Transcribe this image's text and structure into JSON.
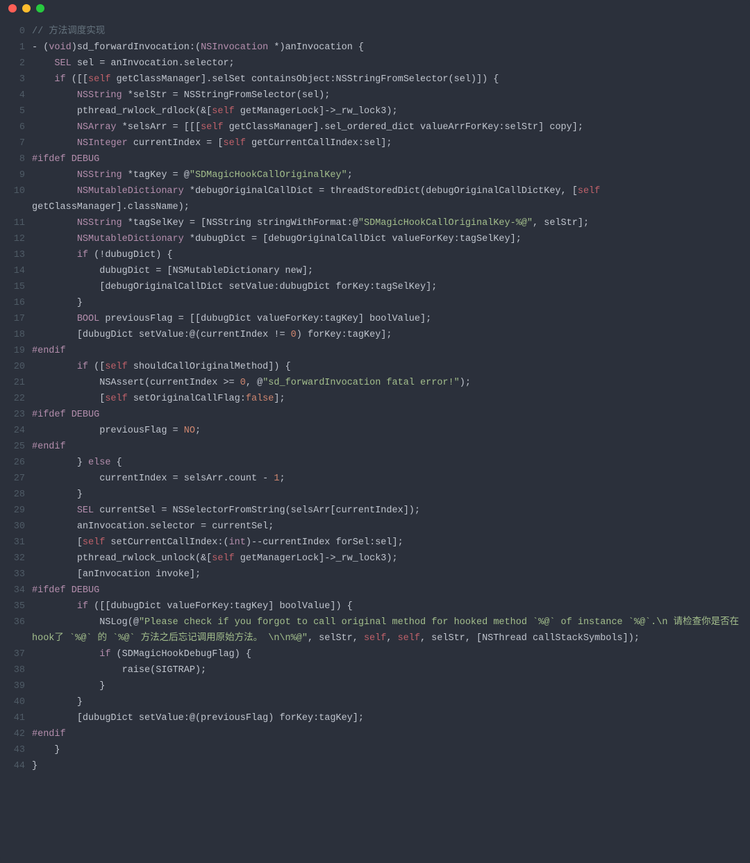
{
  "titlebar": {
    "dots": [
      "close",
      "minimize",
      "zoom"
    ]
  },
  "lines": [
    {
      "n": 0,
      "tokens": [
        {
          "c": "cmt",
          "t": "// 方法调度实现"
        }
      ]
    },
    {
      "n": 1,
      "tokens": [
        {
          "c": "op",
          "t": "- ("
        },
        {
          "c": "typ",
          "t": "void"
        },
        {
          "c": "op",
          "t": ")sd_forwardInvocation:("
        },
        {
          "c": "typ",
          "t": "NSInvocation"
        },
        {
          "c": "op",
          "t": " *)anInvocation {"
        }
      ]
    },
    {
      "n": 2,
      "tokens": [
        {
          "c": "op",
          "t": "    "
        },
        {
          "c": "typ",
          "t": "SEL"
        },
        {
          "c": "op",
          "t": " sel = anInvocation.selector;"
        }
      ]
    },
    {
      "n": 3,
      "tokens": [
        {
          "c": "op",
          "t": "    "
        },
        {
          "c": "kw",
          "t": "if"
        },
        {
          "c": "op",
          "t": " ([["
        },
        {
          "c": "self",
          "t": "self"
        },
        {
          "c": "op",
          "t": " getClassManager].selSet containsObject:NSStringFromSelector(sel)]) {"
        }
      ]
    },
    {
      "n": 4,
      "tokens": [
        {
          "c": "op",
          "t": "        "
        },
        {
          "c": "typ",
          "t": "NSString"
        },
        {
          "c": "op",
          "t": " *selStr = NSStringFromSelector(sel);"
        }
      ]
    },
    {
      "n": 5,
      "tokens": [
        {
          "c": "op",
          "t": "        pthread_rwlock_rdlock(&["
        },
        {
          "c": "self",
          "t": "self"
        },
        {
          "c": "op",
          "t": " getManagerLock]->_rw_lock3);"
        }
      ]
    },
    {
      "n": 6,
      "tokens": [
        {
          "c": "op",
          "t": "        "
        },
        {
          "c": "typ",
          "t": "NSArray"
        },
        {
          "c": "op",
          "t": " *selsArr = [[["
        },
        {
          "c": "self",
          "t": "self"
        },
        {
          "c": "op",
          "t": " getClassManager].sel_ordered_dict valueArrForKey:selStr] "
        },
        {
          "c": "fn",
          "t": "copy"
        },
        {
          "c": "op",
          "t": "];"
        }
      ]
    },
    {
      "n": 7,
      "tokens": [
        {
          "c": "op",
          "t": "        "
        },
        {
          "c": "typ",
          "t": "NSInteger"
        },
        {
          "c": "op",
          "t": " currentIndex = ["
        },
        {
          "c": "self",
          "t": "self"
        },
        {
          "c": "op",
          "t": " getCurrentCallIndex:sel];"
        }
      ]
    },
    {
      "n": 8,
      "tokens": [
        {
          "c": "pre",
          "t": "#ifdef DEBUG"
        }
      ]
    },
    {
      "n": 9,
      "tokens": [
        {
          "c": "op",
          "t": "        "
        },
        {
          "c": "typ",
          "t": "NSString"
        },
        {
          "c": "op",
          "t": " *tagKey = @"
        },
        {
          "c": "str",
          "t": "\"SDMagicHookCallOriginalKey\""
        },
        {
          "c": "op",
          "t": ";"
        }
      ]
    },
    {
      "n": 10,
      "tokens": [
        {
          "c": "op",
          "t": "        "
        },
        {
          "c": "typ",
          "t": "NSMutableDictionary"
        },
        {
          "c": "op",
          "t": " *debugOriginalCallDict = threadStoredDict(debugOriginalCallDictKey, ["
        },
        {
          "c": "self",
          "t": "self"
        },
        {
          "c": "op",
          "t": " getClassManager].className);"
        }
      ]
    },
    {
      "n": 11,
      "tokens": [
        {
          "c": "op",
          "t": "        "
        },
        {
          "c": "typ",
          "t": "NSString"
        },
        {
          "c": "op",
          "t": " *tagSelKey = [NSString stringWithFormat:@"
        },
        {
          "c": "str",
          "t": "\"SDMagicHookCallOriginalKey-%@\""
        },
        {
          "c": "op",
          "t": ", selStr];"
        }
      ]
    },
    {
      "n": 12,
      "tokens": [
        {
          "c": "op",
          "t": "        "
        },
        {
          "c": "typ",
          "t": "NSMutableDictionary"
        },
        {
          "c": "op",
          "t": " *dubugDict = [debugOriginalCallDict valueForKey:tagSelKey];"
        }
      ]
    },
    {
      "n": 13,
      "tokens": [
        {
          "c": "op",
          "t": "        "
        },
        {
          "c": "kw",
          "t": "if"
        },
        {
          "c": "op",
          "t": " (!dubugDict) {"
        }
      ]
    },
    {
      "n": 14,
      "tokens": [
        {
          "c": "op",
          "t": "            dubugDict = [NSMutableDictionary new];"
        }
      ]
    },
    {
      "n": 15,
      "tokens": [
        {
          "c": "op",
          "t": "            [debugOriginalCallDict setValue:dubugDict forKey:tagSelKey];"
        }
      ]
    },
    {
      "n": 16,
      "tokens": [
        {
          "c": "op",
          "t": "        }"
        }
      ]
    },
    {
      "n": 17,
      "tokens": [
        {
          "c": "op",
          "t": "        "
        },
        {
          "c": "typ",
          "t": "BOOL"
        },
        {
          "c": "op",
          "t": " previousFlag = [[dubugDict valueForKey:tagKey] boolValue];"
        }
      ]
    },
    {
      "n": 18,
      "tokens": [
        {
          "c": "op",
          "t": "        [dubugDict setValue:@(currentIndex != "
        },
        {
          "c": "num",
          "t": "0"
        },
        {
          "c": "op",
          "t": ") forKey:tagKey];"
        }
      ]
    },
    {
      "n": 19,
      "tokens": [
        {
          "c": "pre",
          "t": "#endif"
        }
      ]
    },
    {
      "n": 20,
      "tokens": [
        {
          "c": "op",
          "t": "        "
        },
        {
          "c": "kw",
          "t": "if"
        },
        {
          "c": "op",
          "t": " (["
        },
        {
          "c": "self",
          "t": "self"
        },
        {
          "c": "op",
          "t": " shouldCallOriginalMethod]) {"
        }
      ]
    },
    {
      "n": 21,
      "tokens": [
        {
          "c": "op",
          "t": "            NSAssert(currentIndex >= "
        },
        {
          "c": "num",
          "t": "0"
        },
        {
          "c": "op",
          "t": ", @"
        },
        {
          "c": "str",
          "t": "\"sd_forwardInvocation fatal error!\""
        },
        {
          "c": "op",
          "t": ");"
        }
      ]
    },
    {
      "n": 22,
      "tokens": [
        {
          "c": "op",
          "t": "            ["
        },
        {
          "c": "self",
          "t": "self"
        },
        {
          "c": "op",
          "t": " setOriginalCallFlag:"
        },
        {
          "c": "con",
          "t": "false"
        },
        {
          "c": "op",
          "t": "];"
        }
      ]
    },
    {
      "n": 23,
      "tokens": [
        {
          "c": "pre",
          "t": "#ifdef DEBUG"
        }
      ]
    },
    {
      "n": 24,
      "tokens": [
        {
          "c": "op",
          "t": "            previousFlag = "
        },
        {
          "c": "con",
          "t": "NO"
        },
        {
          "c": "op",
          "t": ";"
        }
      ]
    },
    {
      "n": 25,
      "tokens": [
        {
          "c": "pre",
          "t": "#endif"
        }
      ]
    },
    {
      "n": 26,
      "tokens": [
        {
          "c": "op",
          "t": "        } "
        },
        {
          "c": "kw",
          "t": "else"
        },
        {
          "c": "op",
          "t": " {"
        }
      ]
    },
    {
      "n": 27,
      "tokens": [
        {
          "c": "op",
          "t": "            currentIndex = selsArr.count - "
        },
        {
          "c": "num",
          "t": "1"
        },
        {
          "c": "op",
          "t": ";"
        }
      ]
    },
    {
      "n": 28,
      "tokens": [
        {
          "c": "op",
          "t": "        }"
        }
      ]
    },
    {
      "n": 29,
      "tokens": [
        {
          "c": "op",
          "t": "        "
        },
        {
          "c": "typ",
          "t": "SEL"
        },
        {
          "c": "op",
          "t": " currentSel = NSSelectorFromString(selsArr[currentIndex]);"
        }
      ]
    },
    {
      "n": 30,
      "tokens": [
        {
          "c": "op",
          "t": "        anInvocation.selector = currentSel;"
        }
      ]
    },
    {
      "n": 31,
      "tokens": [
        {
          "c": "op",
          "t": "        ["
        },
        {
          "c": "self",
          "t": "self"
        },
        {
          "c": "op",
          "t": " setCurrentCallIndex:("
        },
        {
          "c": "typ",
          "t": "int"
        },
        {
          "c": "op",
          "t": ")--currentIndex forSel:sel];"
        }
      ]
    },
    {
      "n": 32,
      "tokens": [
        {
          "c": "op",
          "t": "        pthread_rwlock_unlock(&["
        },
        {
          "c": "self",
          "t": "self"
        },
        {
          "c": "op",
          "t": " getManagerLock]->_rw_lock3);"
        }
      ]
    },
    {
      "n": 33,
      "tokens": [
        {
          "c": "op",
          "t": "        [anInvocation invoke];"
        }
      ]
    },
    {
      "n": 34,
      "tokens": [
        {
          "c": "pre",
          "t": "#ifdef DEBUG"
        }
      ]
    },
    {
      "n": 35,
      "tokens": [
        {
          "c": "op",
          "t": "        "
        },
        {
          "c": "kw",
          "t": "if"
        },
        {
          "c": "op",
          "t": " ([[dubugDict valueForKey:tagKey] boolValue]) {"
        }
      ]
    },
    {
      "n": 36,
      "tokens": [
        {
          "c": "op",
          "t": "            NSLog(@"
        },
        {
          "c": "str",
          "t": "\"Please check if you forgot to call original method for hooked method `%@` of instance `%@`.\\n 请检查你是否在hook了 `%@` 的 `%@` 方法之后忘记调用原始方法。 \\n\\n%@\""
        },
        {
          "c": "op",
          "t": ", selStr, "
        },
        {
          "c": "self",
          "t": "self"
        },
        {
          "c": "op",
          "t": ", "
        },
        {
          "c": "self",
          "t": "self"
        },
        {
          "c": "op",
          "t": ", selStr, [NSThread callStackSymbols]);"
        }
      ]
    },
    {
      "n": 37,
      "tokens": [
        {
          "c": "op",
          "t": "            "
        },
        {
          "c": "kw",
          "t": "if"
        },
        {
          "c": "op",
          "t": " (SDMagicHookDebugFlag) {"
        }
      ]
    },
    {
      "n": 38,
      "tokens": [
        {
          "c": "op",
          "t": "                raise(SIGTRAP);"
        }
      ]
    },
    {
      "n": 39,
      "tokens": [
        {
          "c": "op",
          "t": "            }"
        }
      ]
    },
    {
      "n": 40,
      "tokens": [
        {
          "c": "op",
          "t": "        }"
        }
      ]
    },
    {
      "n": 41,
      "tokens": [
        {
          "c": "op",
          "t": "        [dubugDict setValue:@(previousFlag) forKey:tagKey];"
        }
      ]
    },
    {
      "n": 42,
      "tokens": [
        {
          "c": "pre",
          "t": "#endif"
        }
      ]
    },
    {
      "n": 43,
      "tokens": [
        {
          "c": "op",
          "t": "    }"
        }
      ]
    },
    {
      "n": 44,
      "tokens": [
        {
          "c": "op",
          "t": "}"
        }
      ]
    }
  ]
}
